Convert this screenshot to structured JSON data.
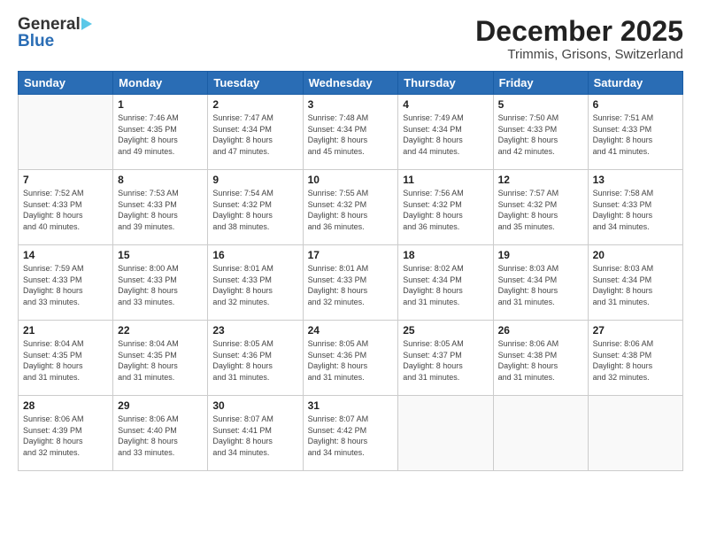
{
  "logo": {
    "general": "General",
    "blue": "Blue"
  },
  "title": {
    "month": "December 2025",
    "location": "Trimmis, Grisons, Switzerland"
  },
  "calendar": {
    "headers": [
      "Sunday",
      "Monday",
      "Tuesday",
      "Wednesday",
      "Thursday",
      "Friday",
      "Saturday"
    ],
    "weeks": [
      [
        {
          "day": "",
          "info": ""
        },
        {
          "day": "1",
          "info": "Sunrise: 7:46 AM\nSunset: 4:35 PM\nDaylight: 8 hours\nand 49 minutes."
        },
        {
          "day": "2",
          "info": "Sunrise: 7:47 AM\nSunset: 4:34 PM\nDaylight: 8 hours\nand 47 minutes."
        },
        {
          "day": "3",
          "info": "Sunrise: 7:48 AM\nSunset: 4:34 PM\nDaylight: 8 hours\nand 45 minutes."
        },
        {
          "day": "4",
          "info": "Sunrise: 7:49 AM\nSunset: 4:34 PM\nDaylight: 8 hours\nand 44 minutes."
        },
        {
          "day": "5",
          "info": "Sunrise: 7:50 AM\nSunset: 4:33 PM\nDaylight: 8 hours\nand 42 minutes."
        },
        {
          "day": "6",
          "info": "Sunrise: 7:51 AM\nSunset: 4:33 PM\nDaylight: 8 hours\nand 41 minutes."
        }
      ],
      [
        {
          "day": "7",
          "info": "Sunrise: 7:52 AM\nSunset: 4:33 PM\nDaylight: 8 hours\nand 40 minutes."
        },
        {
          "day": "8",
          "info": "Sunrise: 7:53 AM\nSunset: 4:33 PM\nDaylight: 8 hours\nand 39 minutes."
        },
        {
          "day": "9",
          "info": "Sunrise: 7:54 AM\nSunset: 4:32 PM\nDaylight: 8 hours\nand 38 minutes."
        },
        {
          "day": "10",
          "info": "Sunrise: 7:55 AM\nSunset: 4:32 PM\nDaylight: 8 hours\nand 36 minutes."
        },
        {
          "day": "11",
          "info": "Sunrise: 7:56 AM\nSunset: 4:32 PM\nDaylight: 8 hours\nand 36 minutes."
        },
        {
          "day": "12",
          "info": "Sunrise: 7:57 AM\nSunset: 4:32 PM\nDaylight: 8 hours\nand 35 minutes."
        },
        {
          "day": "13",
          "info": "Sunrise: 7:58 AM\nSunset: 4:33 PM\nDaylight: 8 hours\nand 34 minutes."
        }
      ],
      [
        {
          "day": "14",
          "info": "Sunrise: 7:59 AM\nSunset: 4:33 PM\nDaylight: 8 hours\nand 33 minutes."
        },
        {
          "day": "15",
          "info": "Sunrise: 8:00 AM\nSunset: 4:33 PM\nDaylight: 8 hours\nand 33 minutes."
        },
        {
          "day": "16",
          "info": "Sunrise: 8:01 AM\nSunset: 4:33 PM\nDaylight: 8 hours\nand 32 minutes."
        },
        {
          "day": "17",
          "info": "Sunrise: 8:01 AM\nSunset: 4:33 PM\nDaylight: 8 hours\nand 32 minutes."
        },
        {
          "day": "18",
          "info": "Sunrise: 8:02 AM\nSunset: 4:34 PM\nDaylight: 8 hours\nand 31 minutes."
        },
        {
          "day": "19",
          "info": "Sunrise: 8:03 AM\nSunset: 4:34 PM\nDaylight: 8 hours\nand 31 minutes."
        },
        {
          "day": "20",
          "info": "Sunrise: 8:03 AM\nSunset: 4:34 PM\nDaylight: 8 hours\nand 31 minutes."
        }
      ],
      [
        {
          "day": "21",
          "info": "Sunrise: 8:04 AM\nSunset: 4:35 PM\nDaylight: 8 hours\nand 31 minutes."
        },
        {
          "day": "22",
          "info": "Sunrise: 8:04 AM\nSunset: 4:35 PM\nDaylight: 8 hours\nand 31 minutes."
        },
        {
          "day": "23",
          "info": "Sunrise: 8:05 AM\nSunset: 4:36 PM\nDaylight: 8 hours\nand 31 minutes."
        },
        {
          "day": "24",
          "info": "Sunrise: 8:05 AM\nSunset: 4:36 PM\nDaylight: 8 hours\nand 31 minutes."
        },
        {
          "day": "25",
          "info": "Sunrise: 8:05 AM\nSunset: 4:37 PM\nDaylight: 8 hours\nand 31 minutes."
        },
        {
          "day": "26",
          "info": "Sunrise: 8:06 AM\nSunset: 4:38 PM\nDaylight: 8 hours\nand 31 minutes."
        },
        {
          "day": "27",
          "info": "Sunrise: 8:06 AM\nSunset: 4:38 PM\nDaylight: 8 hours\nand 32 minutes."
        }
      ],
      [
        {
          "day": "28",
          "info": "Sunrise: 8:06 AM\nSunset: 4:39 PM\nDaylight: 8 hours\nand 32 minutes."
        },
        {
          "day": "29",
          "info": "Sunrise: 8:06 AM\nSunset: 4:40 PM\nDaylight: 8 hours\nand 33 minutes."
        },
        {
          "day": "30",
          "info": "Sunrise: 8:07 AM\nSunset: 4:41 PM\nDaylight: 8 hours\nand 34 minutes."
        },
        {
          "day": "31",
          "info": "Sunrise: 8:07 AM\nSunset: 4:42 PM\nDaylight: 8 hours\nand 34 minutes."
        },
        {
          "day": "",
          "info": ""
        },
        {
          "day": "",
          "info": ""
        },
        {
          "day": "",
          "info": ""
        }
      ]
    ]
  }
}
